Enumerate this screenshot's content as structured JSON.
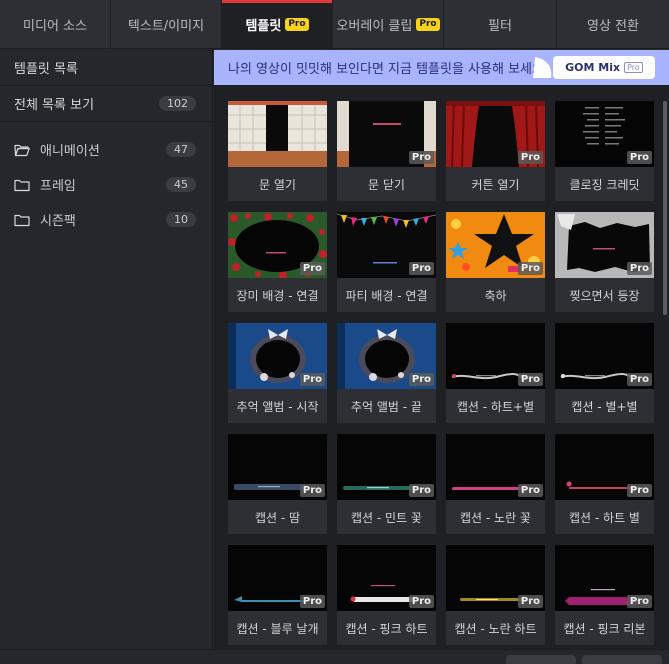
{
  "tabs": [
    {
      "label": "미디어 소스",
      "pro": false
    },
    {
      "label": "텍스트/이미지",
      "pro": false
    },
    {
      "label": "템플릿",
      "pro": true
    },
    {
      "label": "오버레이 클립",
      "pro": true
    },
    {
      "label": "필터",
      "pro": false
    },
    {
      "label": "영상 전환",
      "pro": false
    }
  ],
  "pro_label": "Pro",
  "sidebar": {
    "title": "템플릿 목록",
    "all_label": "전체 목록 보기",
    "all_count": "102",
    "categories": [
      {
        "label": "애니메이션",
        "count": "47",
        "icon": "folder-open-icon"
      },
      {
        "label": "프레임",
        "count": "45",
        "icon": "folder-icon"
      },
      {
        "label": "시즌팩",
        "count": "10",
        "icon": "folder-icon"
      }
    ]
  },
  "banner": {
    "text": "나의 영상이 밋밋해 보인다면 지금 템플릿을 사용해 보세요.",
    "brand": "GOM Mix",
    "brand_pro": "Pro"
  },
  "templates": [
    {
      "name": "문 열기",
      "pro": false
    },
    {
      "name": "문 닫기",
      "pro": true
    },
    {
      "name": "커튼 열기",
      "pro": true
    },
    {
      "name": "클로징 크레딧",
      "pro": true
    },
    {
      "name": "장미 배경 - 연결",
      "pro": true
    },
    {
      "name": "파티 배경 - 연결",
      "pro": true
    },
    {
      "name": "축하",
      "pro": true
    },
    {
      "name": "찢으면서 등장",
      "pro": true
    },
    {
      "name": "추억 앨범 - 시작",
      "pro": true
    },
    {
      "name": "추억 앨범 - 끝",
      "pro": true
    },
    {
      "name": "캡션 - 하트+별",
      "pro": true
    },
    {
      "name": "캡션 - 별+별",
      "pro": true
    },
    {
      "name": "캡션 - 땀",
      "pro": true
    },
    {
      "name": "캡션 - 민트 꽃",
      "pro": true
    },
    {
      "name": "캡션 - 노란 꽃",
      "pro": true
    },
    {
      "name": "캡션 - 하트 별",
      "pro": true
    },
    {
      "name": "캡션 - 블루 날개",
      "pro": true
    },
    {
      "name": "캡션 - 핑크 하트",
      "pro": true
    },
    {
      "name": "캡션 - 노란 하트",
      "pro": true
    },
    {
      "name": "캡션 - 핑크 리본",
      "pro": true
    }
  ],
  "colors": {
    "accent": "#e03a3a",
    "pro_badge": "#f7d21b",
    "banner_bg": "#a9b4ff"
  }
}
